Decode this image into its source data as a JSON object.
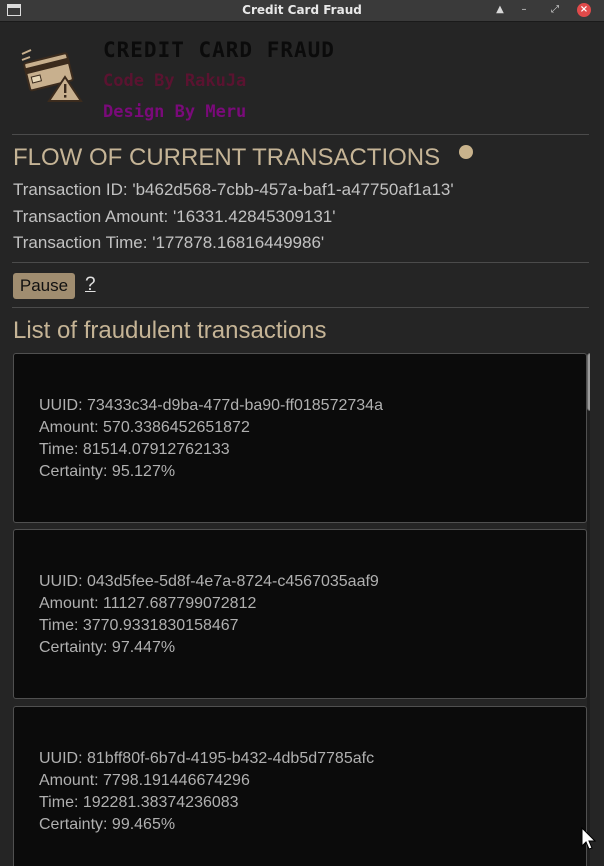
{
  "window": {
    "title": "Credit Card Fraud"
  },
  "header": {
    "title": "CREDIT CARD FRAUD",
    "code_by": "Code By RakuJa",
    "design_by": "Design By Meru"
  },
  "flow": {
    "heading": "FLOW OF CURRENT TRANSACTIONS",
    "transaction_id": "Transaction ID: 'b462d568-7cbb-457a-baf1-a47750af1a13'",
    "transaction_amount": "Transaction Amount: '16331.42845309131'",
    "transaction_time": "Transaction Time: '177878.16816449986'",
    "status_color": "#c9b38c"
  },
  "controls": {
    "pause_label": "Pause",
    "help_label": "?"
  },
  "fraud_list": {
    "heading": "List of fraudulent transactions",
    "items": [
      {
        "uuid": "UUID: 73433c34-d9ba-477d-ba90-ff018572734a",
        "amount": "Amount: 570.3386452651872",
        "time": "Time: 81514.07912762133",
        "certainty": "Certainty: 95.127%"
      },
      {
        "uuid": "UUID: 043d5fee-5d8f-4e7a-8724-c4567035aaf9",
        "amount": "Amount: 11127.687799072812",
        "time": "Time: 3770.9331830158467",
        "certainty": "Certainty: 97.447%"
      },
      {
        "uuid": "UUID: 81bff80f-6b7d-4195-b432-4db5d7785afc",
        "amount": "Amount: 7798.191446674296",
        "time": "Time: 192281.38374236083",
        "certainty": "Certainty: 99.465%"
      }
    ]
  },
  "colors": {
    "accent": "#c5b496",
    "background": "#252525",
    "card_background": "#0b0b0b",
    "code_by": "#5a1330",
    "design_by": "#7a0a7a"
  },
  "icons": {
    "app": "window-icon",
    "logo": "credit-card-warning-icon",
    "status": "status-dot-icon"
  }
}
